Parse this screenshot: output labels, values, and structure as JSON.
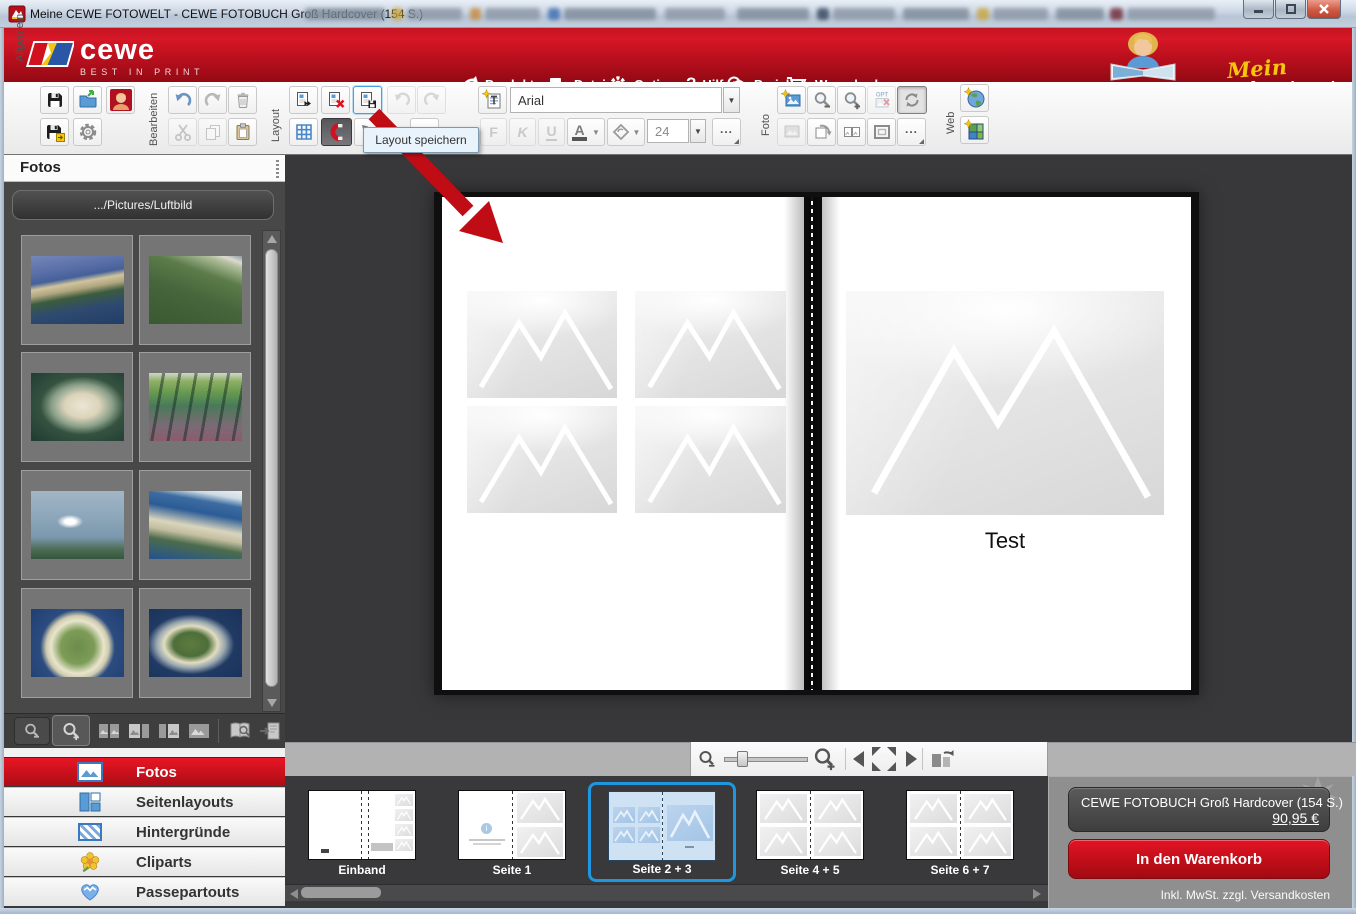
{
  "window": {
    "title": "Meine CEWE FOTOWELT - CEWE FOTOBUCH Groß Hardcover  (154 S.)"
  },
  "menubar": {
    "logo": {
      "name": "cewe",
      "tagline": "BEST IN PRINT"
    },
    "items": [
      {
        "label": "Produkte"
      },
      {
        "label": "Datei"
      },
      {
        "label": "Optionen"
      },
      {
        "label": "Hilfe"
      },
      {
        "label": "Preisliste"
      },
      {
        "label": "Warenkorb"
      }
    ],
    "help_glyph": "?",
    "brand": {
      "mein": "Mein",
      "cewe": "cewe",
      "fotobuch": "fotobuch"
    }
  },
  "toolbar": {
    "group_labels": {
      "allgemein": "Allgemein",
      "bearbeiten": "Bearbeiten",
      "layout": "Layout",
      "foto": "Foto",
      "web": "Web"
    },
    "font_family_value": "Arial",
    "font_size_value": "24",
    "bold_label": "F",
    "italic_label": "K",
    "underline_label": "U",
    "color_label": "A",
    "opt_label": "OPT",
    "more_label": "..."
  },
  "annotation": {
    "tooltip": "Layout speichern"
  },
  "sidebar": {
    "header": "Fotos",
    "path_button": ".../Pictures/Luftbild",
    "nav": [
      {
        "label": "Fotos",
        "selected": true
      },
      {
        "label": "Seitenlayouts",
        "selected": false
      },
      {
        "label": "Hintergründe",
        "selected": false
      },
      {
        "label": "Cliparts",
        "selected": false
      },
      {
        "label": "Passepartouts",
        "selected": false
      }
    ]
  },
  "canvas": {
    "text_element": "Test"
  },
  "pagebar": {
    "items": [
      {
        "label": "Einband",
        "selected": false
      },
      {
        "label": "Seite 1",
        "selected": false
      },
      {
        "label": "Seite 2 + 3",
        "selected": true
      },
      {
        "label": "Seite 4 + 5",
        "selected": false
      },
      {
        "label": "Seite 6 + 7",
        "selected": false
      }
    ]
  },
  "cart": {
    "product": "CEWE FOTOBUCH Groß Hardcover  (154 S.)",
    "price": "90,95 €",
    "add_button": "In den Warenkorb",
    "note": "Inkl. MwSt. zzgl. Versandkosten"
  },
  "colors": {
    "cewe_red": "#c11120",
    "selection_blue": "#1f97e0",
    "canvas_dark": "#39393b"
  }
}
